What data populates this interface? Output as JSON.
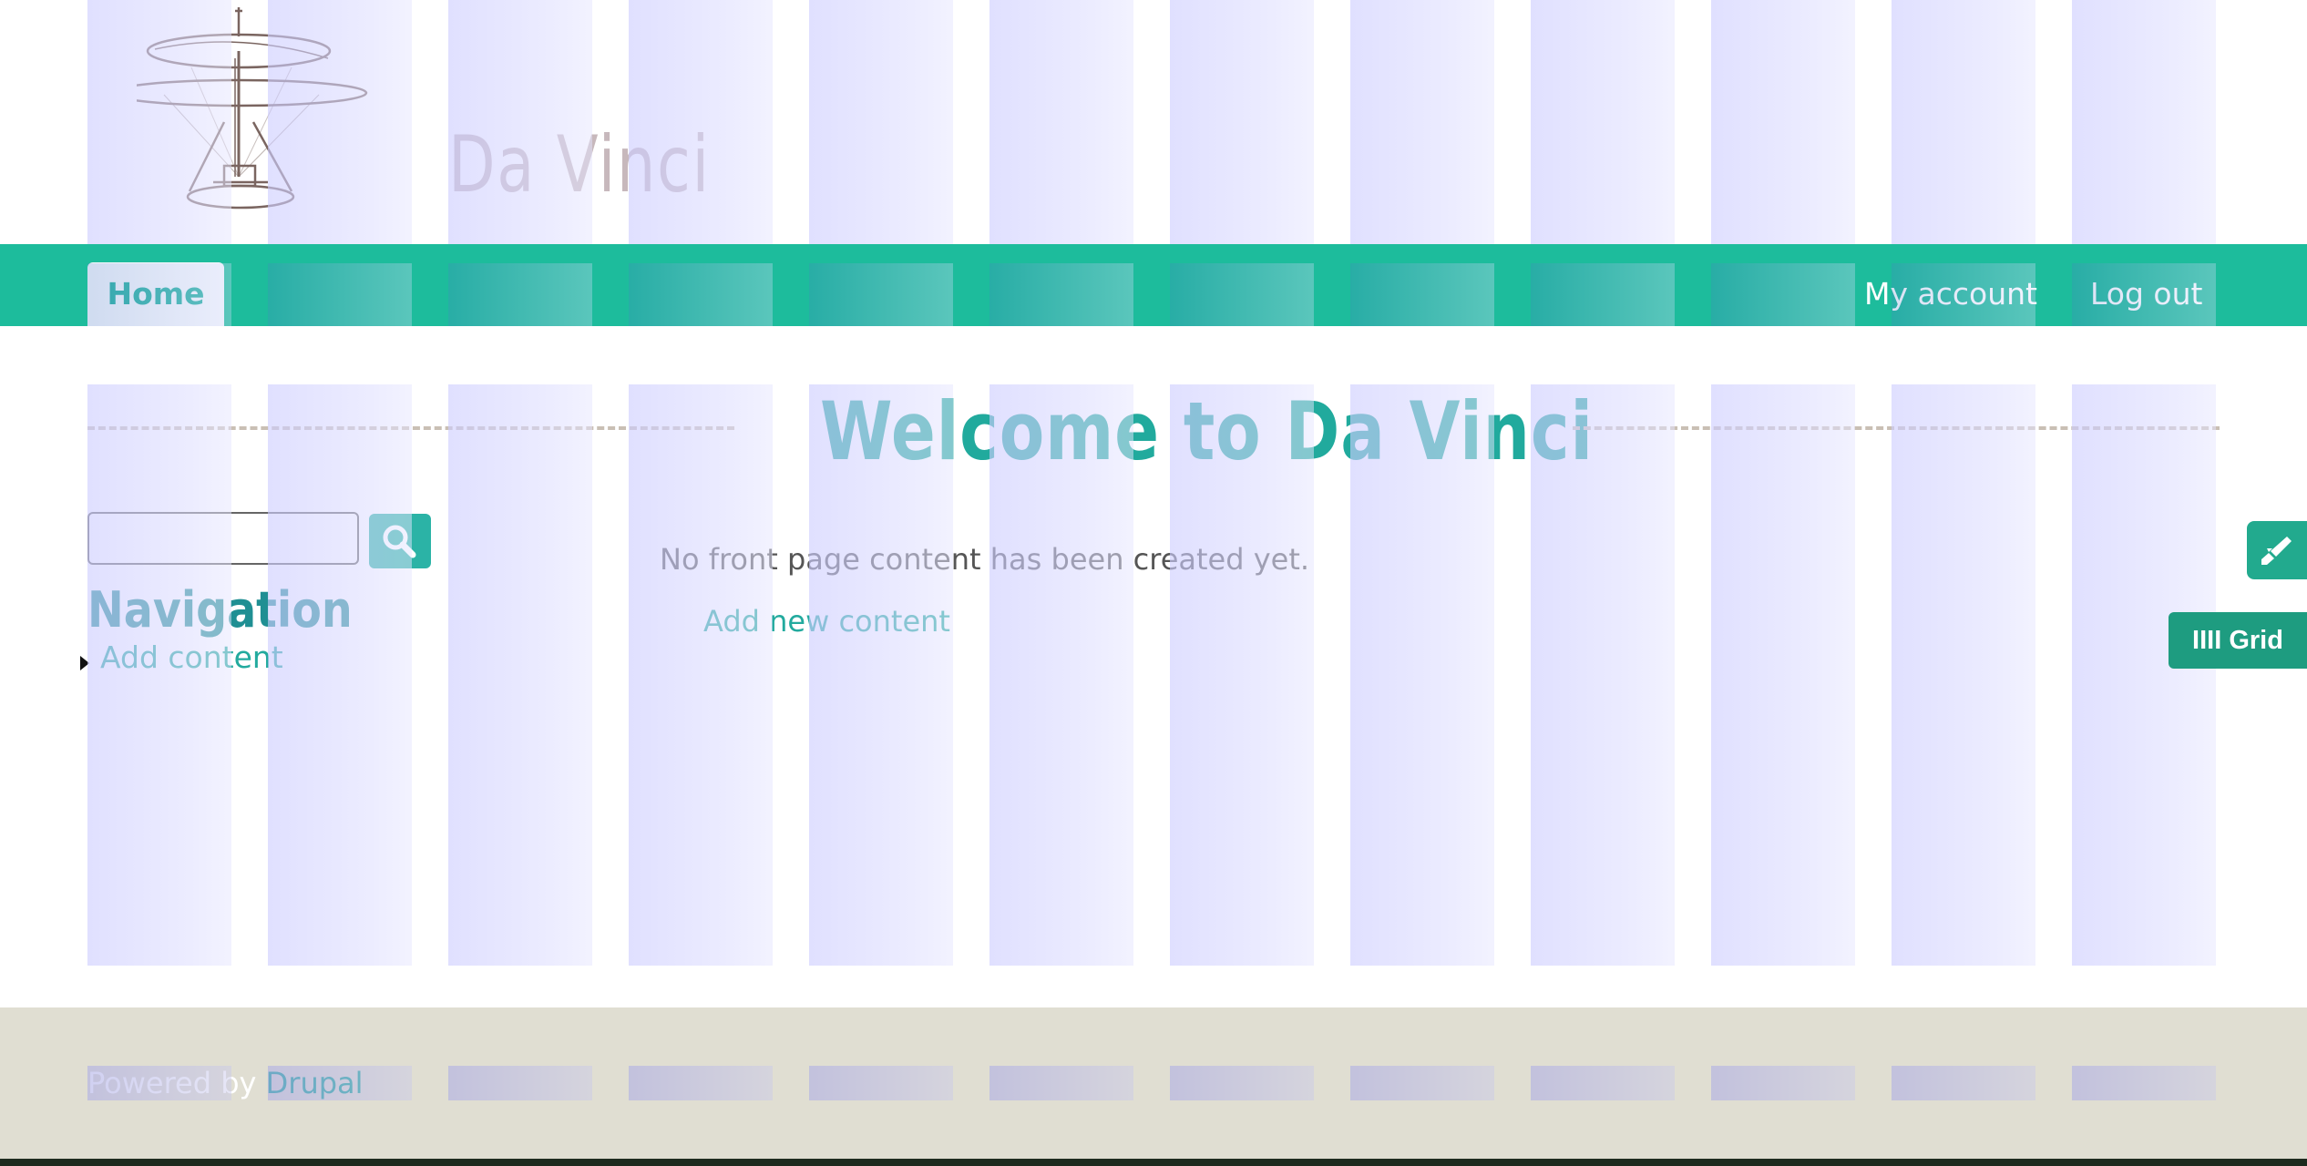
{
  "site": {
    "name": "Da Vinci",
    "logo_icon": "helicopter-sketch-icon"
  },
  "nav": {
    "home_label": "Home",
    "my_account_label": "My account",
    "log_out_label": "Log out"
  },
  "main": {
    "title": "Welcome to Da Vinci",
    "empty_text": "No front page content has been created yet.",
    "add_new_content_label": "Add new content"
  },
  "sidebar": {
    "search_placeholder": "",
    "search_icon": "search-icon",
    "navigation_heading": "Navigation",
    "add_content_label": "Add content"
  },
  "footer": {
    "powered_by_text": "Powered by ",
    "drupal_label": "Drupal"
  },
  "widgets": {
    "paint_icon": "rocket-brush-icon",
    "grid_label": "IIII Grid"
  },
  "colors": {
    "accent": "#1dbc9c",
    "link": "#22aa9e",
    "title": "#21aa9d",
    "footer_bg": "#e0ded2",
    "grid_overlay": "#d8d8ff"
  }
}
